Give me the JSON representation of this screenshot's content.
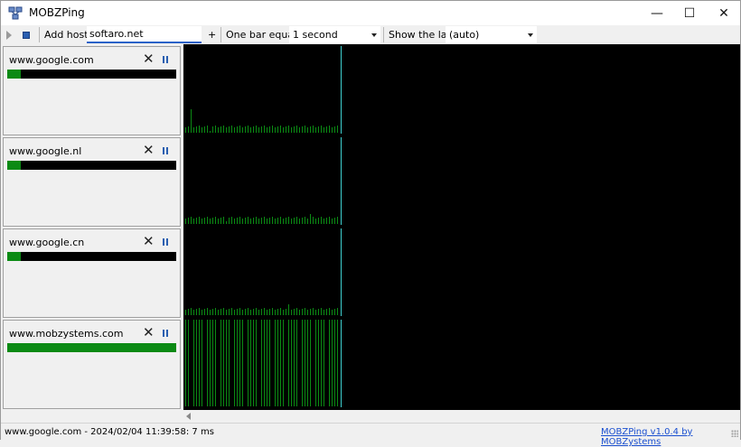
{
  "window": {
    "title": "MOBZPing",
    "minimize_glyph": "—",
    "maximize_glyph": "☐",
    "close_glyph": "✕"
  },
  "toolbar": {
    "add_host_label": "Add host:",
    "add_host_value": "softaro.net",
    "add_button": "+",
    "bar_label": "One bar equals:",
    "bar_value": "1 second",
    "show_last_label": "Show the last:",
    "show_last_value": "(auto)"
  },
  "hosts": [
    {
      "name": "www.google.com",
      "level": 0.08
    },
    {
      "name": "www.google.nl",
      "level": 0.08
    },
    {
      "name": "www.google.cn",
      "level": 0.08
    },
    {
      "name": "www.mobzystems.com",
      "level": 1.0
    }
  ],
  "panel_icons": {
    "remove": "✕"
  },
  "status": {
    "text": "www.google.com - 2024/02/04 11:39:58: 7 ms",
    "about_link": "MOBZPing v1.0.4 by MOBZystems"
  },
  "colors": {
    "bar_green": "#0b8a14",
    "graph_bg": "#000000",
    "cursor_line": "#3fd0d0",
    "link_blue": "#1a4fd0"
  }
}
